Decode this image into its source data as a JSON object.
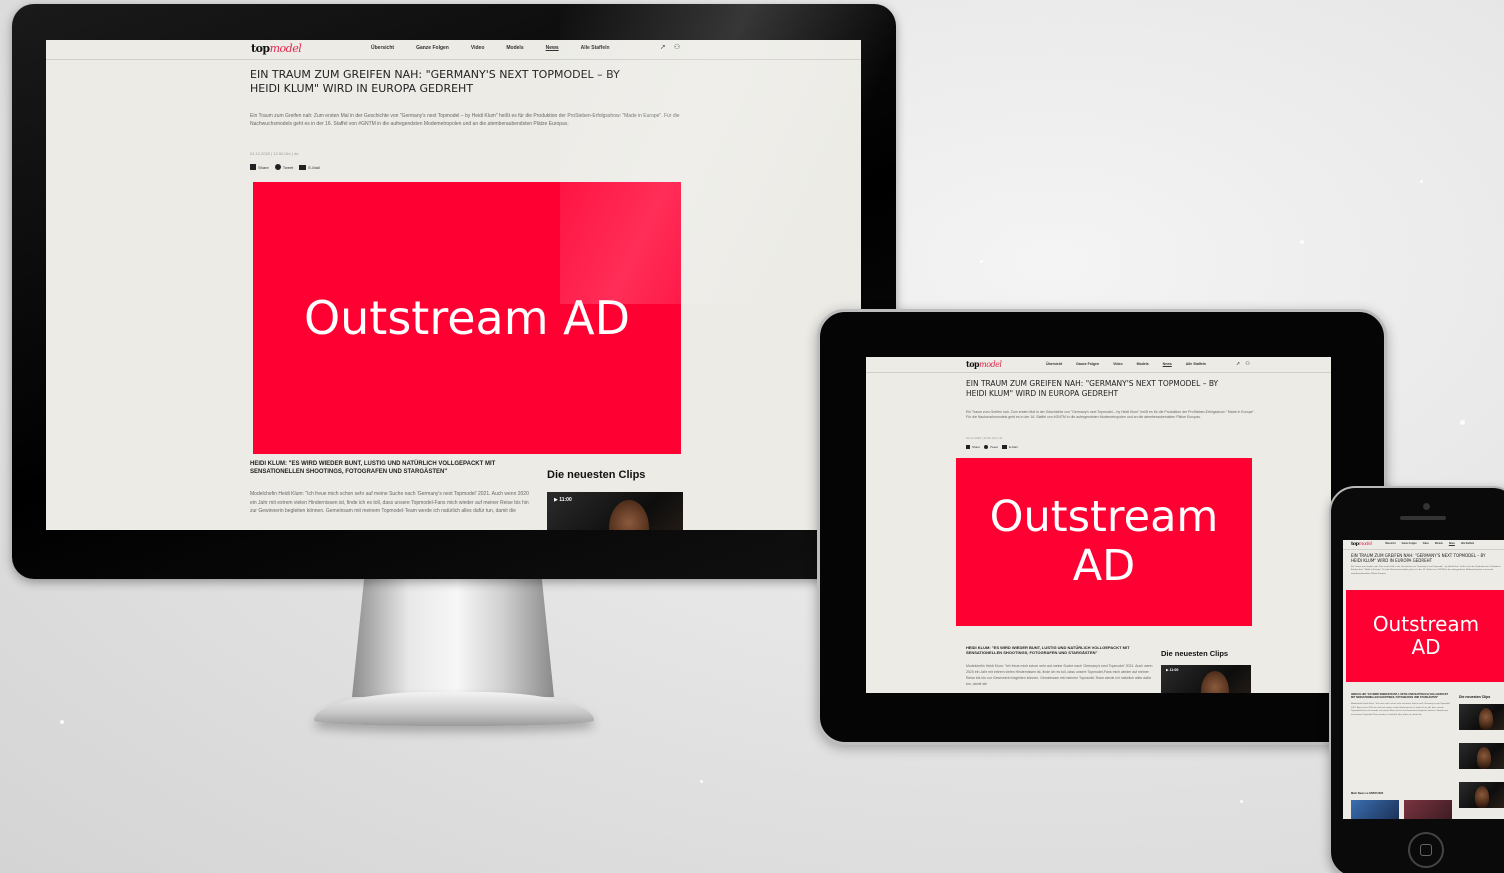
{
  "site": {
    "logo_prefix": "top",
    "logo_suffix": "model",
    "nav": [
      "Übersicht",
      "Ganze Folgen",
      "Video",
      "Models",
      "News",
      "Alle Staffeln"
    ],
    "active_nav": "News"
  },
  "article": {
    "headline_line1": "EIN TRAUM ZUM GREIFEN NAH: \"GERMANY'S NEXT TOPMODEL – BY",
    "headline_line2": "HEIDI KLUM\" WIRD IN EUROPA GEDREHT",
    "lead": "Ein Traum zum Greifen nah: Zum ersten Mal in der Geschichte von \"Germany's next Topmodel – by Heidi Klum\" heißt es für die Produktion der ProSieben-Erfolgsshow: \"Made in Europe\". Für die Nachwuchsmodels geht es in der 16. Staffel von #GNTM in die aufregendsten Modemetropolen und an die atemberaubendsten Plätze Europas.",
    "meta": "01.12.2020 | 12:00 Uhr | ds",
    "share": [
      "Share",
      "Tweet",
      "E-Mail"
    ],
    "subheadline": "HEIDI KLUM: \"ES WIRD WIEDER BUNT, LUSTIG UND NATÜRLICH VOLLGEPACKT MIT SENSATIONELLEN SHOOTINGS, FOTOGRAFEN UND STARGÄSTEN\"",
    "body": "Modelchefin Heidi Klum: \"Ich freue mich schon sehr auf meine Suche nach 'Germany's next Topmodel' 2021. Auch wenn 2020 ein Jahr mit extrem vielen Hindernissen ist, finde ich es toll, dass unsere Topmodel-Fans mich wieder auf meiner Reise bis hin zur Gewinnerin begleiten können. Gemeinsam mit meinem Topmodel-Team werde ich natürlich alles dafür tun, damit die"
  },
  "sidebar": {
    "clips_title": "Die neuesten Clips",
    "clip_duration": "▶ 11:00"
  },
  "ad": {
    "label_desktop": "Outstream AD",
    "label_tablet_line1": "Outstream",
    "label_tablet_line2": "AD",
    "label_phone_line1": "Outstream",
    "label_phone_line2": "AD",
    "color": "#ff0033"
  },
  "phone": {
    "more_news": "Mehr News zu GNTM 2020"
  },
  "colors": {
    "page_bg": "#ecebe6",
    "ad_red": "#ff0033",
    "logo_accent": "#e0274d"
  }
}
